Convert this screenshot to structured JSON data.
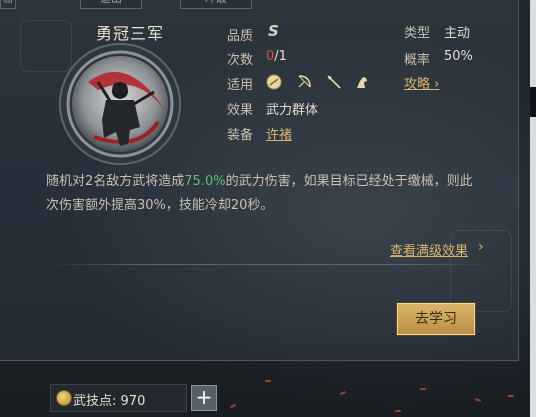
{
  "top_tabs": [
    "易",
    "速出",
    "冲破"
  ],
  "skill": {
    "name": "勇冠三军",
    "quality_label": "品质",
    "quality_value": "S",
    "uses_label": "次数",
    "uses_current": "0",
    "uses_total": "/1",
    "applies_label": "适用",
    "effect_label": "效果",
    "effect_value": "武力群体",
    "equip_label": "装备",
    "equip_value": "许褚",
    "type_label": "类型",
    "type_value": "主动",
    "rate_label": "概率",
    "rate_value": "50%",
    "guide_link": "攻略",
    "weapon_icons": [
      "shield-icon",
      "bow-icon",
      "spear-icon",
      "horse-icon"
    ]
  },
  "description": {
    "part1": "随机对2名敌方武将造成",
    "highlight": "75.0%",
    "part2": "的武力伤害，如果目标已经处于缴械，则此次伤害额外提高30%，技能冷却20秒。"
  },
  "full_effect_link": "查看满级效果",
  "learn_button": "去学习",
  "skill_points": {
    "label": "武技点:",
    "value": "970"
  },
  "colors": {
    "gold": "#d9b66a",
    "green": "#5fbf6e",
    "red": "#e04a3f"
  }
}
